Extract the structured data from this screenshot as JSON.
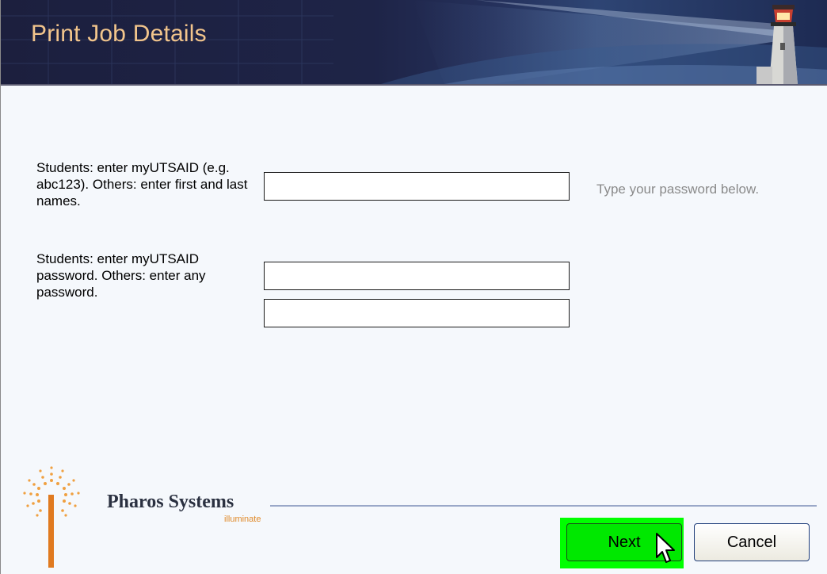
{
  "header": {
    "title": "Print Job Details"
  },
  "form": {
    "username_label": "Students: enter myUTSAID (e.g. abc123). Others: enter first and last names.",
    "username_value": "",
    "password_label": "Students: enter myUTSAID password. Others: enter any password.",
    "password_value": "",
    "password_confirm_value": "",
    "hint": "Type your password below."
  },
  "brand": {
    "name": "Pharos Systems",
    "tagline": "illuminate"
  },
  "buttons": {
    "next_label": "Next",
    "cancel_label": "Cancel"
  },
  "colors": {
    "header_bg": "#1e2447",
    "title_color": "#f2c58c",
    "next_highlight": "#00ff00",
    "brand_accent": "#e08a2a"
  },
  "icons": {
    "lighthouse": "lighthouse-icon",
    "logo_burst": "pharos-logo-icon",
    "cursor": "mouse-pointer-icon"
  }
}
